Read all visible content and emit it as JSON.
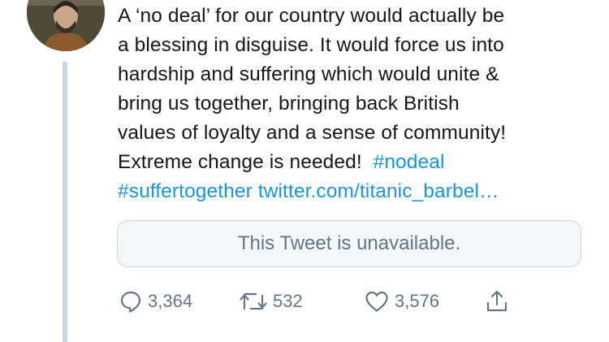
{
  "tweet": {
    "lines": [
      "A ‘no deal’ for our country would actually be",
      "a blessing in disguise. It would force us into",
      "hardship and suffering which would unite &",
      "bring us together, bringing back British",
      "values of loyalty and a sense of community!",
      "Extreme change is needed!"
    ],
    "hashtag_nodeal": "#nodeal",
    "hashtag_suffertogether": "#suffertogether",
    "link": "twitter.com/titanic_barbel…"
  },
  "quoted_tweet": {
    "text": "This Tweet is unavailable."
  },
  "actions": {
    "reply_count": "3,364",
    "retweet_count": "532",
    "like_count": "3,576",
    "reply_icon": "speech-bubble",
    "retweet_icon": "retweet-arrows",
    "like_icon": "heart-outline",
    "share_icon": "share-arrow-up"
  },
  "colors": {
    "text": "#14171a",
    "link": "#1b95e0",
    "muted": "#657786",
    "border": "#ccd6dd",
    "quote_bg": "#f5f8fa"
  }
}
